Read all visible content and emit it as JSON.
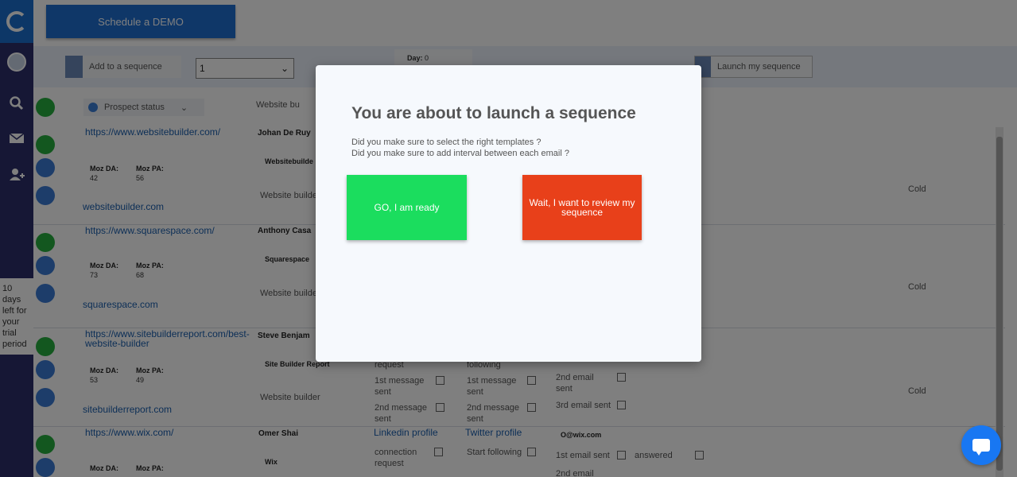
{
  "topbar": {
    "demo_label": "Schedule a DEMO"
  },
  "sidebar": {
    "trial_text": "10 days left for your trial period"
  },
  "toolbar": {
    "add_label": "Add to a sequence",
    "select_value": "1",
    "day_label": "Day:",
    "day_value": "0",
    "launch_label": "Launch my sequence"
  },
  "header": {
    "status_label": "Prospect status",
    "website_label": "Website bu"
  },
  "rows": [
    {
      "url": "https://www.websitebuilder.com/",
      "name": "Johan De Ruy",
      "company": "Websitebuilde",
      "builder": "Website builde",
      "domain": "websitebuilder.com",
      "moz_da_label": "Moz DA:",
      "moz_da": "42",
      "moz_pa_label": "Moz PA:",
      "moz_pa": "56",
      "status": "Cold"
    },
    {
      "url": "https://www.squarespace.com/",
      "name": "Anthony Casa",
      "company": "Squarespace",
      "builder": "Website builde",
      "domain": "squarespace.com",
      "moz_da_label": "Moz DA:",
      "moz_da": "73",
      "moz_pa_label": "Moz PA:",
      "moz_pa": "68",
      "status": "Cold"
    },
    {
      "url": "https://www.sitebuilderreport.com/best-website-builder",
      "name": "Steve Benjam",
      "company": "Site Builder Report",
      "builder": "Website builder",
      "domain": "sitebuilderreport.com",
      "moz_da_label": "Moz DA:",
      "moz_da": "53",
      "moz_pa_label": "Moz PA:",
      "moz_pa": "49",
      "status": "Cold",
      "cols": {
        "request": "request",
        "following": "following",
        "msg1_li": "1st message sent",
        "msg2_li": "2nd message sent",
        "msg1_tw": "1st message sent",
        "msg2_tw": "2nd message sent",
        "email2": "2nd email sent",
        "email3": "3rd email sent"
      }
    },
    {
      "url": "https://www.wix.com/",
      "name": "Omer Shai",
      "company": "Wix",
      "linkedin": "Linkedin profile",
      "twitter": "Twitter profile",
      "email": "O@wix.com",
      "moz_da_label": "Moz DA:",
      "moz_pa_label": "Moz PA:",
      "cols": {
        "connection": "connection request",
        "start": "Start following",
        "email1": "1st email sent",
        "answered": "answered",
        "email2": "2nd email"
      }
    }
  ],
  "modal": {
    "title": "You are about to launch a sequence",
    "q1": "Did you make sure to select the right templates ?",
    "q2": "Did you make sure to add interval between each email ?",
    "go_label": "GO, I am ready",
    "wait_label": "Wait, I want to review my sequence"
  },
  "colors": {
    "sidebar": "#2c2f6b",
    "primary": "#1f6fd1",
    "go": "#1bdd5e",
    "wait": "#e8401a",
    "check": "#27ae3e"
  }
}
